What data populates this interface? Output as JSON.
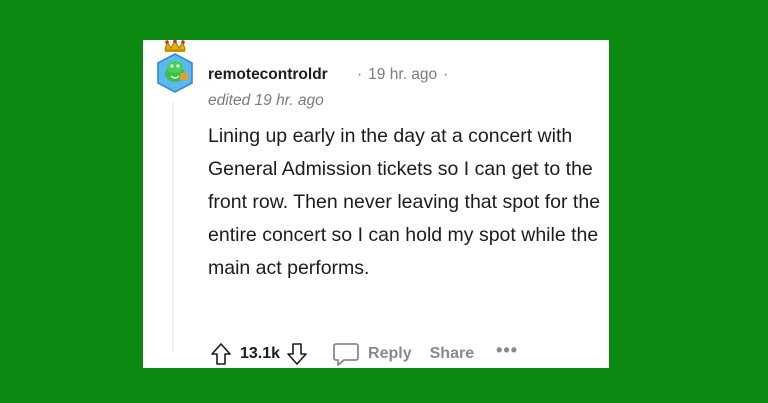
{
  "comment": {
    "username": "remotecontroldr",
    "separator": "·",
    "timestamp": "19 hr. ago",
    "edited": "edited 19 hr. ago",
    "body": "Lining up early in the day at a concert with General Admission tickets so I can get to the front row. Then never leaving that spot for the entire concert so I can hold my spot while the main act performs."
  },
  "actions": {
    "score": "13.1k",
    "reply_label": "Reply",
    "share_label": "Share",
    "more_label": "•••"
  },
  "icons": {
    "upvote": "arrow-up-icon",
    "downvote": "arrow-down-icon",
    "reply": "speech-bubble-icon",
    "avatar": "snoo-avatar-with-crown"
  },
  "colors": {
    "background": "#0b8a12",
    "card": "#ffffff",
    "meta_text": "#7c7c7c",
    "action_text": "#878a8c"
  }
}
